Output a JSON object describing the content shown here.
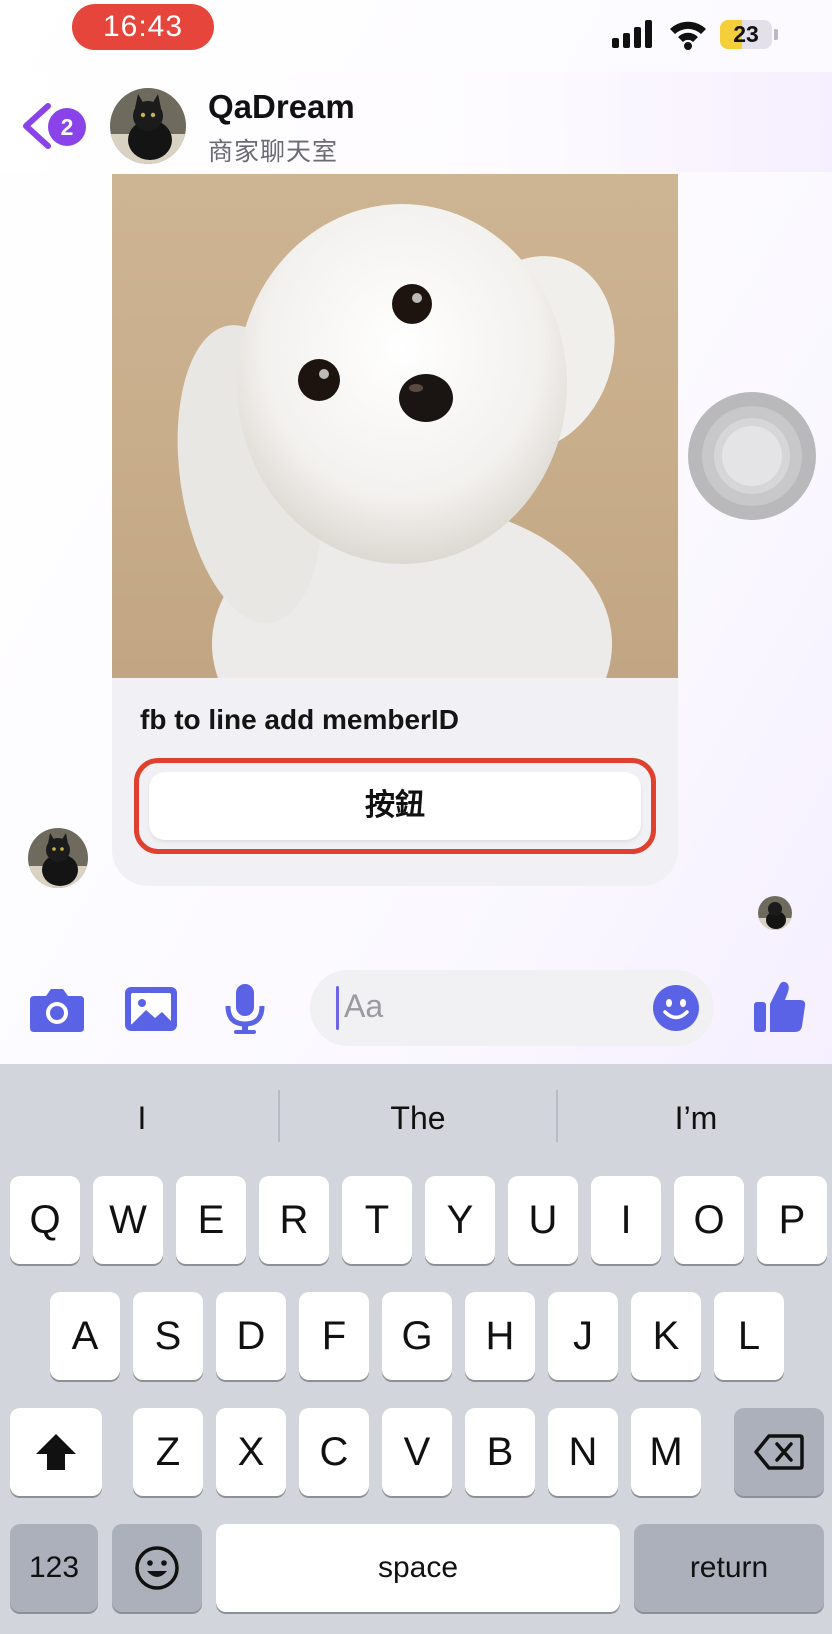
{
  "status_bar": {
    "time": "16:43",
    "battery": "23"
  },
  "header": {
    "back_badge": "2",
    "title": "QaDream",
    "subtitle": "商家聊天室"
  },
  "card": {
    "title": "fb to line add memberID",
    "button_label": "按鈕"
  },
  "composer": {
    "placeholder": "Aa"
  },
  "keyboard": {
    "suggestions": [
      "I",
      "The",
      "I’m"
    ],
    "row1": [
      "Q",
      "W",
      "E",
      "R",
      "T",
      "Y",
      "U",
      "I",
      "O",
      "P"
    ],
    "row2": [
      "A",
      "S",
      "D",
      "F",
      "G",
      "H",
      "J",
      "K",
      "L"
    ],
    "row3": [
      "Z",
      "X",
      "C",
      "V",
      "B",
      "N",
      "M"
    ],
    "numbers_key": "123",
    "space_key": "space",
    "return_key": "return"
  },
  "colors": {
    "accent": "#5a63e6",
    "badge": "#8a43e8",
    "highlight_border": "#e0402e",
    "time_pill": "#e5453a"
  },
  "icons": [
    "back-chevron-icon",
    "camera-icon",
    "image-icon",
    "microphone-icon",
    "emoji-icon",
    "thumbs-up-icon",
    "shift-icon",
    "backspace-icon",
    "keyboard-emoji-icon",
    "assistive-touch-icon"
  ]
}
